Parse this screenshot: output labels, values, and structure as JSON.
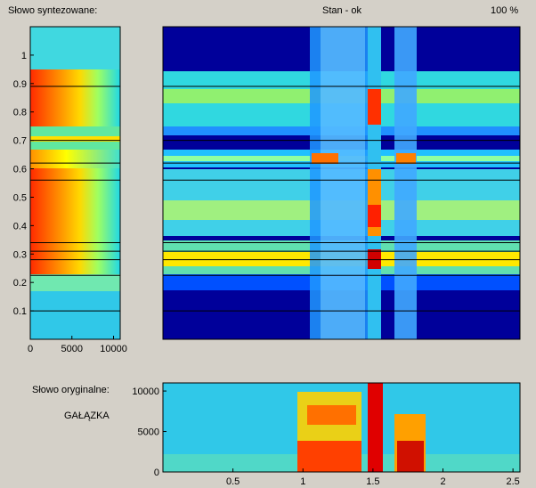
{
  "header": {
    "synth_label": "Słowo syntezowane:",
    "status": "Stan - ok",
    "percent": "100 %"
  },
  "orig": {
    "label": "Słowo oryginalne:",
    "word": "GAŁĄZKA"
  },
  "left_plot": {
    "y_ticks": [
      "1",
      "0.9",
      "0.8",
      "0.7",
      "0.6",
      "0.5",
      "0.4",
      "0.3",
      "0.2",
      "0.1"
    ],
    "y_values": [
      1,
      0.9,
      0.8,
      0.7,
      0.6,
      0.5,
      0.4,
      0.3,
      0.2,
      0.1
    ],
    "ylim": [
      0,
      1.1
    ],
    "x_ticks": [
      "0",
      "5000",
      "10000"
    ],
    "x_values": [
      0,
      5000,
      10000
    ],
    "xlim": [
      0,
      10800
    ],
    "segment_boundaries": [
      0.1,
      0.225,
      0.28,
      0.31,
      0.34,
      0.56,
      0.62,
      0.7,
      0.89
    ]
  },
  "bottom_plot": {
    "y_ticks": [
      "10000",
      "5000",
      "0"
    ],
    "y_values": [
      10000,
      5000,
      0
    ],
    "ylim": [
      0,
      11000
    ],
    "x_ticks": [
      "0.5",
      "1",
      "1.5",
      "2",
      "2.5"
    ],
    "x_values": [
      0.5,
      1,
      1.5,
      2,
      2.5
    ],
    "xlim": [
      0,
      2.55
    ]
  },
  "colors": {
    "background": "#d4d0c8",
    "colormap": [
      "#00008f",
      "#0000ff",
      "#00ffff",
      "#ffff00",
      "#ff0000",
      "#800000"
    ]
  }
}
